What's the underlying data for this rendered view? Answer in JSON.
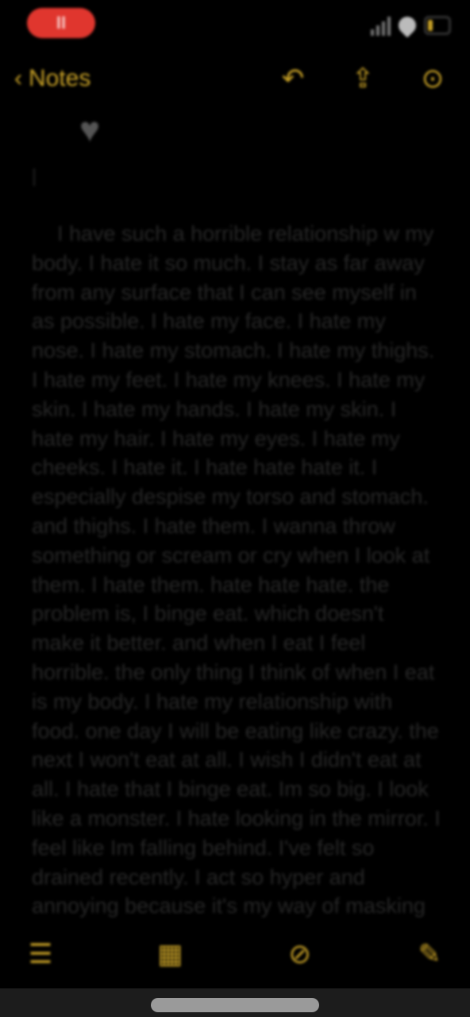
{
  "status": {
    "recording_label": "II",
    "battery_color": "#c9a227"
  },
  "nav": {
    "back_label": "Notes",
    "back_icon": "chevron-left-icon",
    "actions": [
      {
        "name": "undo-icon",
        "glyph": "↶"
      },
      {
        "name": "share-icon",
        "glyph": "⇪"
      },
      {
        "name": "more-icon",
        "glyph": "⊙"
      }
    ]
  },
  "note": {
    "heart_glyph": "♥",
    "body": "I have such a horrible relationship w my body. I hate it so much. I stay as far away from any surface that I can see myself in as possible. I hate my face. I hate my nose. I hate my stomach. I hate my thighs. I hate my feet. I hate my knees. I hate my skin. I hate my hands. I hate my skin. I hate my hair. I hate my eyes. I hate my cheeks. I hate it. I hate hate hate it. I especially despise my torso and stomach. and thighs. I hate them. I wanna throw something or scream or cry when I look at them. I hate them. hate hate hate. the problem is, I binge eat. which doesn't make it better. and when I eat I feel horrible. the only thing I think of when I eat is my body. I hate my relationship with food. one day I will be eating like crazy. the next I won't eat at all. I wish I didn't eat at all. I hate that I binge eat. Im so big. I look like a monster. I hate looking in the mirror. I feel like Im falling behind. I've felt so drained recently. I act so hyper and annoying because it's my way of masking that im slowly dying mentally. I don't have energy. I don't even wanna get out of bed. but on another note, I"
  },
  "toolbar": {
    "items": [
      {
        "name": "checklist-icon",
        "glyph": "☰"
      },
      {
        "name": "table-icon",
        "glyph": "▦"
      },
      {
        "name": "pen-markup-icon",
        "glyph": "⊘"
      },
      {
        "name": "compose-icon",
        "glyph": "✎"
      }
    ]
  },
  "colors": {
    "accent": "#c9a227",
    "background": "#000000",
    "recording": "#e0362e"
  }
}
